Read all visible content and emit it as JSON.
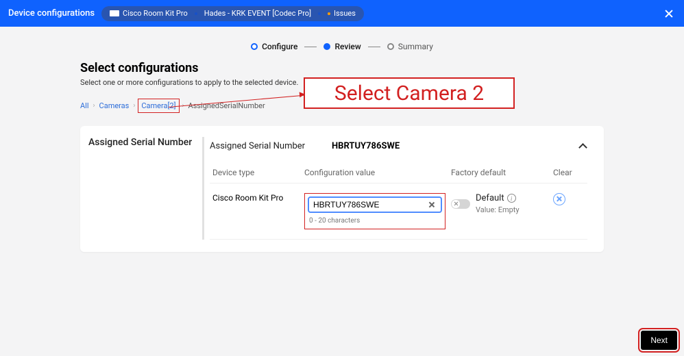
{
  "header": {
    "title": "Device configurations",
    "pills": {
      "device_model": "Cisco Room Kit Pro",
      "device_name": "Hades - KRK EVENT [Codec Pro]",
      "issues": "Issues"
    }
  },
  "stepper": {
    "step1": "Configure",
    "step2": "Review",
    "step3": "Summary"
  },
  "page": {
    "heading": "Select configurations",
    "subheading": "Select one or more configurations to apply to the selected device."
  },
  "breadcrumb": {
    "all": "All",
    "cameras": "Cameras",
    "camera2": "Camera[2]",
    "current": "AssignedSerialNumber"
  },
  "callout": {
    "text": "Select Camera 2"
  },
  "panel": {
    "left_title": "Assigned Serial Number",
    "section_title": "Assigned Serial Number",
    "section_value": "HBRTUY786SWE",
    "columns": {
      "device_type": "Device type",
      "config_value": "Configuration value",
      "factory_default": "Factory default",
      "clear": "Clear"
    },
    "row": {
      "device_type": "Cisco Room Kit Pro",
      "input_value": "HBRTUY786SWE",
      "hint": "0 - 20 characters",
      "default_label": "Default",
      "default_sub": "Value: Empty"
    }
  },
  "footer": {
    "next": "Next"
  }
}
